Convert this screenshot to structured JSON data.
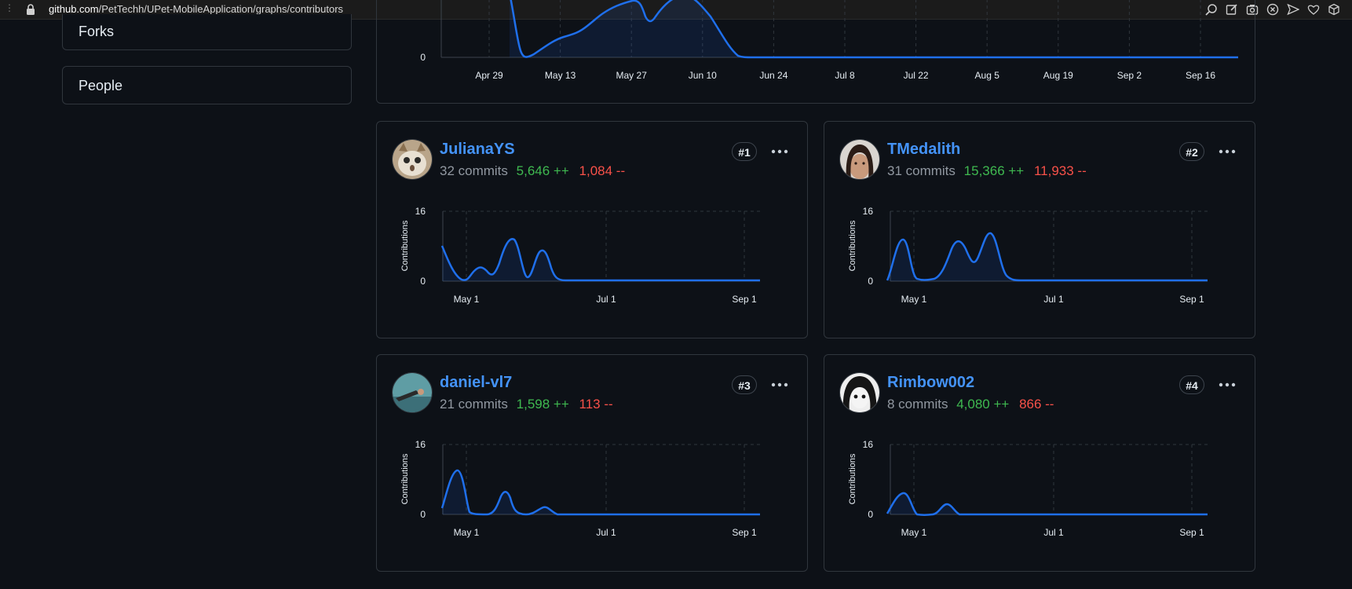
{
  "browser": {
    "url_host": "github.com",
    "url_path": "/PetTechh/UPet-MobileApplication/graphs/contributors",
    "icons": [
      "zoom-icon",
      "edit-icon",
      "screenshot-icon",
      "shield-icon",
      "send-icon",
      "heart-icon",
      "extension-icon"
    ]
  },
  "sidebar": {
    "forks_label": "Forks",
    "people_label": "People"
  },
  "overview": {
    "y_zero": "0",
    "x_ticks": [
      "Apr 29",
      "May 13",
      "May 27",
      "Jun 10",
      "Jun 24",
      "Jul 8",
      "Jul 22",
      "Aug 5",
      "Aug 19",
      "Sep 2",
      "Sep 16"
    ]
  },
  "contributors": [
    {
      "name": "JulianaYS",
      "commits": "32 commits",
      "additions": "5,646 ++",
      "deletions": "1,084 --",
      "rank": "#1",
      "chart": {
        "ylabel": "Contributions",
        "y_max": "16",
        "y_zero": "0",
        "x_ticks": [
          "May 1",
          "Jul 1",
          "Sep 1"
        ]
      }
    },
    {
      "name": "TMedalith",
      "commits": "31 commits",
      "additions": "15,366 ++",
      "deletions": "11,933 --",
      "rank": "#2",
      "chart": {
        "ylabel": "Contributions",
        "y_max": "16",
        "y_zero": "0",
        "x_ticks": [
          "May 1",
          "Jul 1",
          "Sep 1"
        ]
      }
    },
    {
      "name": "daniel-vl7",
      "commits": "21 commits",
      "additions": "1,598 ++",
      "deletions": "113 --",
      "rank": "#3",
      "chart": {
        "ylabel": "Contributions",
        "y_max": "16",
        "y_zero": "0",
        "x_ticks": [
          "May 1",
          "Jul 1",
          "Sep 1"
        ]
      }
    },
    {
      "name": "Rimbow002",
      "commits": "8 commits",
      "additions": "4,080 ++",
      "deletions": "866 --",
      "rank": "#4",
      "chart": {
        "ylabel": "Contributions",
        "y_max": "16",
        "y_zero": "0",
        "x_ticks": [
          "May 1",
          "Jul 1",
          "Sep 1"
        ]
      }
    }
  ],
  "colors": {
    "background": "#0d1117",
    "border": "#30363d",
    "link": "#4493f8",
    "line": "#1f6feb",
    "additions": "#3fb950",
    "deletions": "#f85149",
    "muted": "#9198a1"
  }
}
